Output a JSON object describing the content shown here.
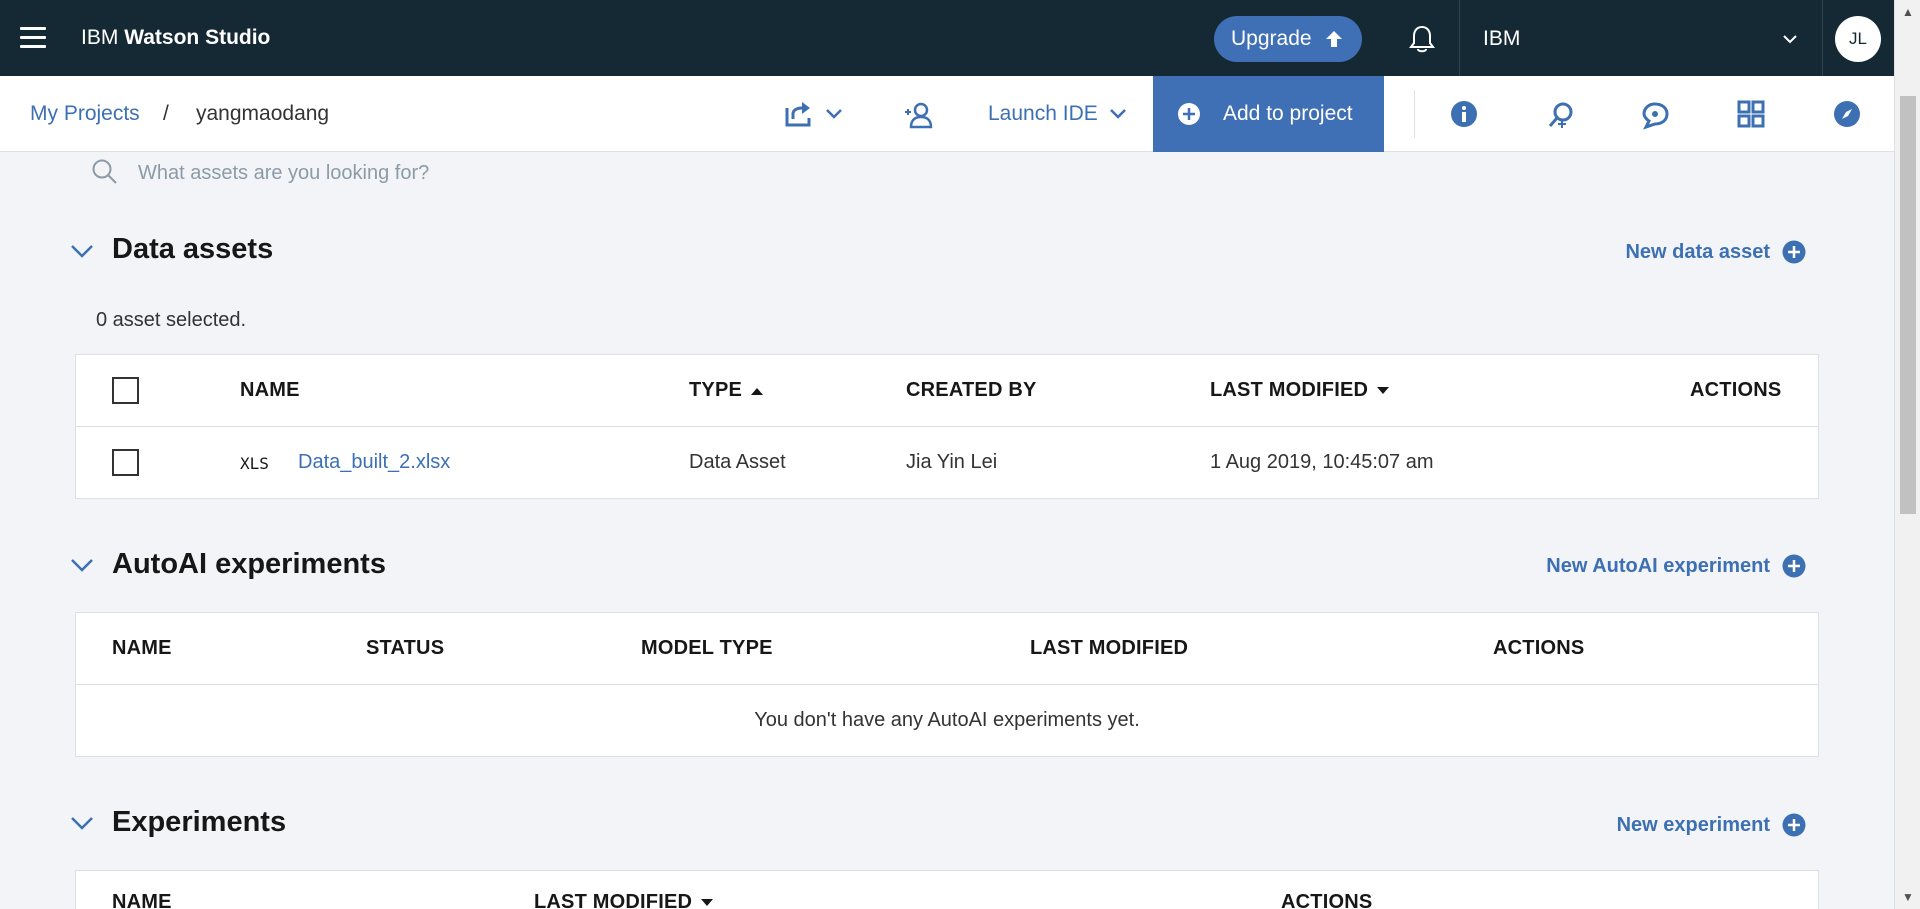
{
  "header": {
    "brand_prefix": "IBM",
    "brand_name": "Watson Studio",
    "upgrade_label": "Upgrade",
    "account_name": "IBM",
    "avatar_initials": "JL"
  },
  "subheader": {
    "breadcrumb_root": "My Projects",
    "breadcrumb_separator": "/",
    "breadcrumb_current": "yangmaodang",
    "launch_ide_label": "Launch IDE",
    "add_to_project_label": "Add to project"
  },
  "search": {
    "placeholder": "What assets are you looking for?"
  },
  "data_assets": {
    "title": "Data assets",
    "new_label": "New data asset",
    "selected_text": "0 asset selected.",
    "columns": {
      "name": "NAME",
      "type": "TYPE",
      "created_by": "CREATED BY",
      "last_modified": "LAST MODIFIED",
      "actions": "ACTIONS"
    },
    "rows": [
      {
        "file_type": "XLS",
        "name": "Data_built_2.xlsx",
        "type": "Data Asset",
        "created_by": "Jia Yin Lei",
        "last_modified": "1 Aug 2019, 10:45:07 am"
      }
    ]
  },
  "autoai": {
    "title": "AutoAI experiments",
    "new_label": "New AutoAI experiment",
    "columns": {
      "name": "NAME",
      "status": "STATUS",
      "model_type": "MODEL TYPE",
      "last_modified": "LAST MODIFIED",
      "actions": "ACTIONS"
    },
    "empty_text": "You don't have any AutoAI experiments yet."
  },
  "experiments": {
    "title": "Experiments",
    "new_label": "New experiment",
    "columns": {
      "name": "NAME",
      "last_modified": "LAST MODIFIED",
      "actions": "ACTIONS"
    }
  },
  "colors": {
    "header_bg": "#152935",
    "accent_blue": "#3f6fb5",
    "link_blue": "#3d70b2",
    "page_bg": "#f2f4f8"
  }
}
